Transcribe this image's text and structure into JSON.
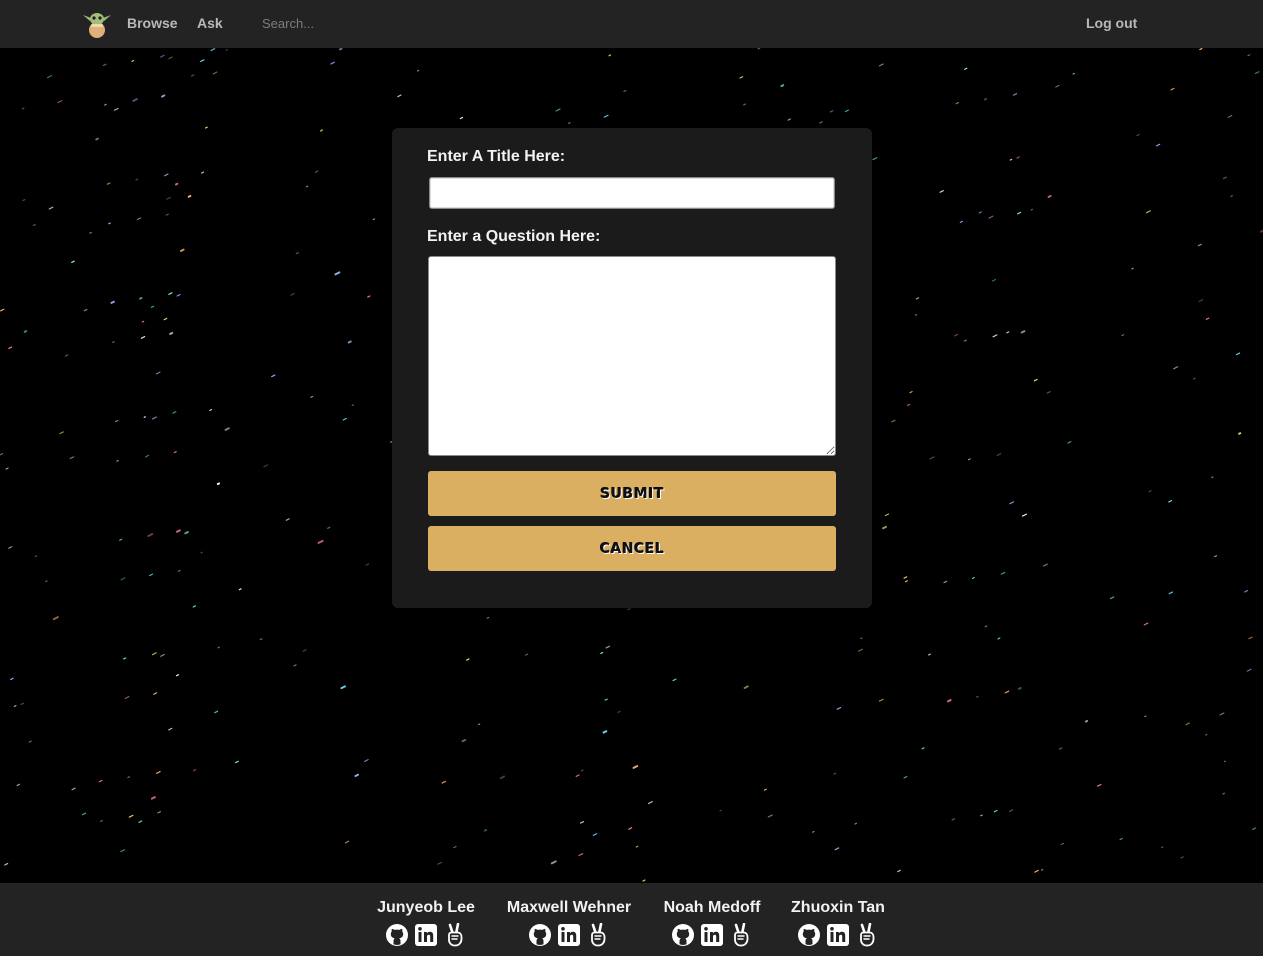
{
  "navbar": {
    "logo_icon": "baby-yoda-icon",
    "links": [
      {
        "label": "Browse"
      },
      {
        "label": "Ask"
      }
    ],
    "search_placeholder": "Search...",
    "logout_label": "Log out"
  },
  "form": {
    "title_label": "Enter A Title Here:",
    "title_value": "",
    "question_label": "Enter a Question Here:",
    "question_value": "",
    "submit_label": "Submit",
    "cancel_label": "Cancel"
  },
  "footer": {
    "members": [
      {
        "name": "Junyeob Lee",
        "icons": [
          "github-icon",
          "linkedin-icon",
          "peace-hand-icon"
        ]
      },
      {
        "name": "Maxwell Wehner",
        "icons": [
          "github-icon",
          "linkedin-icon",
          "peace-hand-icon"
        ]
      },
      {
        "name": "Noah Medoff",
        "icons": [
          "github-icon",
          "linkedin-icon",
          "peace-hand-icon"
        ]
      },
      {
        "name": "Zhuoxin Tan",
        "icons": [
          "github-icon",
          "linkedin-icon",
          "peace-hand-icon"
        ]
      }
    ]
  },
  "colors": {
    "navbar_bg": "#232323",
    "card_bg": "#1b1b1b",
    "button_accent": "#dbaf61",
    "page_bg": "#000000"
  }
}
